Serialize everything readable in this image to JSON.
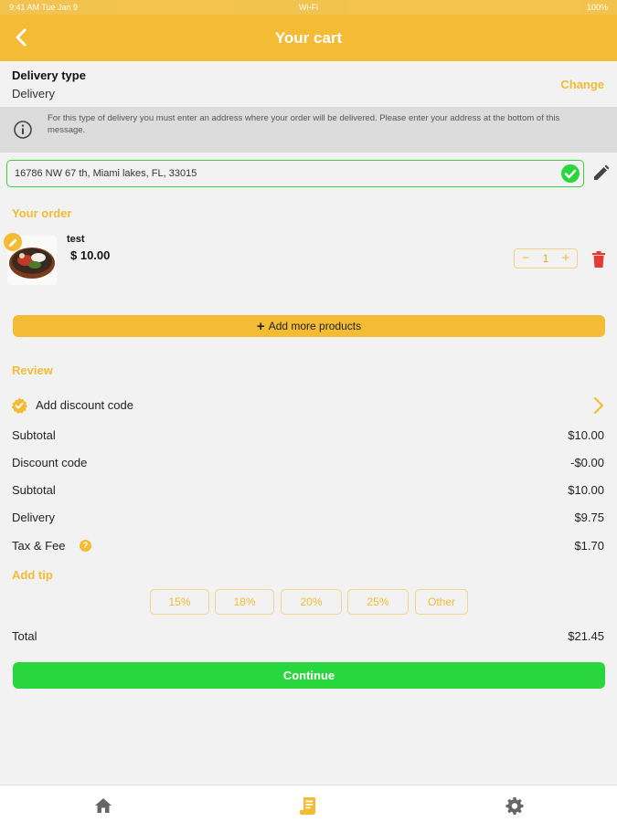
{
  "status_bar": {
    "left": "9:41 AM  Tue Jan 9",
    "center": "Wi-Fi",
    "right": "100%"
  },
  "header": {
    "title": "Your cart",
    "back_icon": "chevron-left-icon"
  },
  "delivery": {
    "label": "Delivery type",
    "value": "Delivery",
    "change_label": "Change"
  },
  "notice": {
    "text": "For this type of delivery you must enter an address where your order will be delivered. Please enter your address at the bottom of this message.",
    "icon": "info-icon"
  },
  "address": {
    "value": "16786 NW 67 th, Miami lakes, FL, 33015",
    "check_icon": "check-circle-icon",
    "edit_icon": "pencil-icon"
  },
  "order": {
    "title": "Your order",
    "items": [
      {
        "name": "test",
        "price": "$ 10.00",
        "quantity": "1",
        "minus": "−",
        "plus": "+"
      }
    ]
  },
  "add_more": {
    "label": "Add more products",
    "icon": "+"
  },
  "review": {
    "title": "Review",
    "discount_label": "Add discount code",
    "rows": [
      {
        "label": "Subtotal",
        "value": "$10.00"
      },
      {
        "label": "Discount code",
        "value": "-$0.00"
      },
      {
        "label": "Subtotal",
        "value": "$10.00"
      },
      {
        "label": "Delivery",
        "value": "$9.75"
      },
      {
        "label": "Tax & Fee",
        "value": "$1.70",
        "help": "?"
      }
    ]
  },
  "tip": {
    "title": "Add tip",
    "options": [
      "15%",
      "18%",
      "20%",
      "25%",
      "Other"
    ]
  },
  "total": {
    "label": "Total",
    "value": "$21.45"
  },
  "continue_label": "Continue",
  "tabs": [
    "home-icon",
    "receipt-icon",
    "gear-icon"
  ],
  "colors": {
    "accent": "#f4bb34",
    "success": "#2ad63e",
    "danger": "#e53935"
  }
}
